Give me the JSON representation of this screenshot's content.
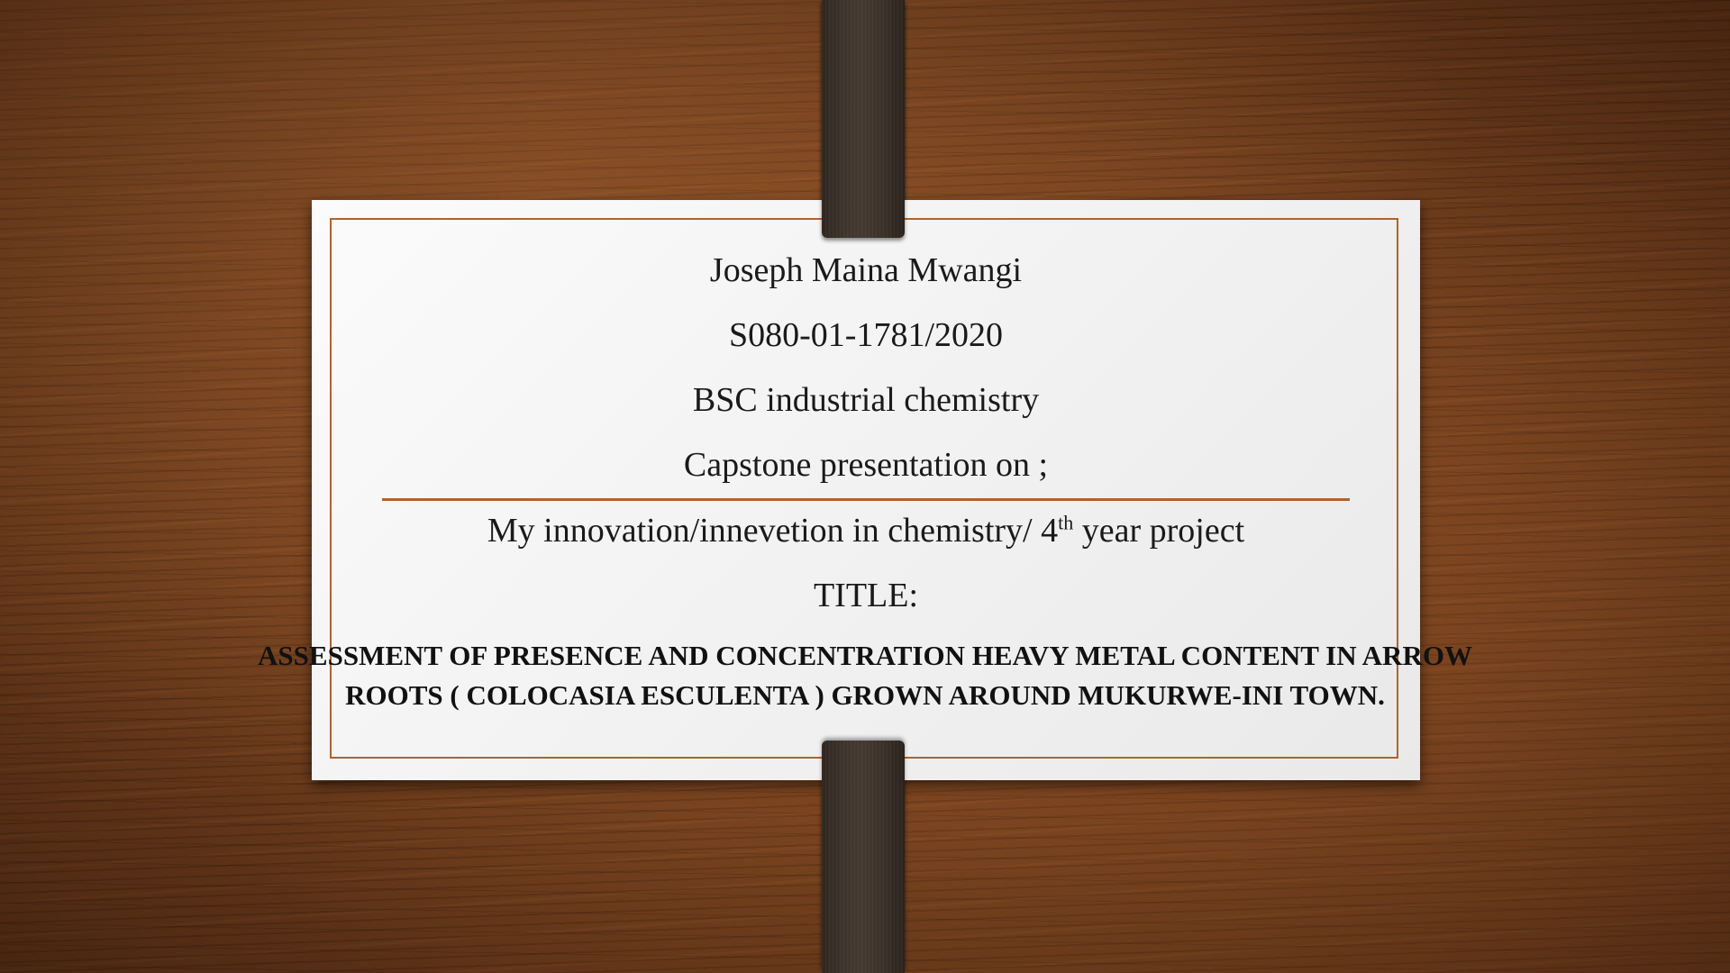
{
  "slide": {
    "author_name": "Joseph Maina Mwangi",
    "registration_number": "S080-01-1781/2020",
    "course": "BSC industrial chemistry",
    "intro_text": "Capstone presentation on ;",
    "subtitle": {
      "before_ordinal": "My innovation/innevetion in chemistry/ 4",
      "ordinal_suffix": "th",
      "after_ordinal": " year project"
    },
    "title_label": "TITLE:",
    "project_title_line1": "ASSESSMENT OF PRESENCE AND CONCENTRATION HEAVY METAL CONTENT IN ARROW",
    "project_title_line2": "ROOTS ( COLOCASIA ESCULENTA ) GROWN AROUND MUKURWE-INI TOWN."
  },
  "colors": {
    "accent": "#b2622b",
    "strap": "#3f362e",
    "card": "#f3f3f3",
    "wood": "#7a4420"
  }
}
